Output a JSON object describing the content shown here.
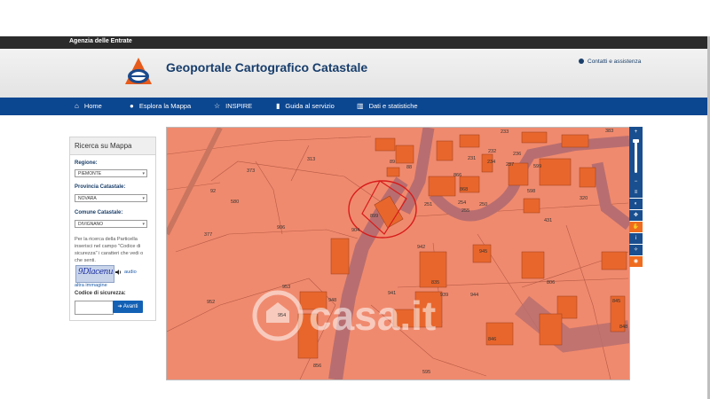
{
  "agency": "Agenzia delle Entrate",
  "header": {
    "title": "Geoportale Cartografico Catastale",
    "contacts": "Contatti e assistenza"
  },
  "nav": [
    {
      "label": "Home",
      "icon": "home-icon"
    },
    {
      "label": "Esplora la Mappa",
      "icon": "globe-icon"
    },
    {
      "label": "INSPIRE",
      "icon": "star-icon"
    },
    {
      "label": "Guida al servizio",
      "icon": "book-icon"
    },
    {
      "label": "Dati e statistiche",
      "icon": "bar-chart-icon"
    }
  ],
  "panel": {
    "title": "Ricerca su Mappa",
    "regione_label": "Regione:",
    "regione_value": "PIEMONTE",
    "provincia_label": "Provincia Catastale:",
    "provincia_value": "NOVARA",
    "comune_label": "Comune Catastale:",
    "comune_value": "DIVIGNANO",
    "instructions": "Per la ricerca della Particella inserisci nel campo \"Codice di sicurezza\" i caratteri che vedi o che senti.",
    "captcha_text": "9Dlacenu",
    "audio_label": "audio",
    "altra_label": "altra immagine",
    "codice_label": "Codice di sicurezza:",
    "codice_value": "",
    "submit_label": "Avanti"
  },
  "map": {
    "watermark": "casa.it",
    "parcels": [
      "233",
      "383",
      "373",
      "313",
      "89",
      "88",
      "231",
      "232",
      "234",
      "236",
      "237",
      "92",
      "580",
      "866",
      "868",
      "599",
      "598",
      "320",
      "251",
      "254",
      "255",
      "250",
      "431",
      "899",
      "377",
      "906",
      "904",
      "942",
      "945",
      "835",
      "806",
      "953",
      "941",
      "939",
      "944",
      "952",
      "954",
      "948",
      "945",
      "848",
      "846",
      "856",
      "595"
    ]
  },
  "toolbar": [
    "zoom-in",
    "zoom-out",
    "layers-icon",
    "contrast-icon",
    "fullscreen-icon",
    "hand-icon",
    "info-icon",
    "locate-icon",
    "eye-icon"
  ]
}
